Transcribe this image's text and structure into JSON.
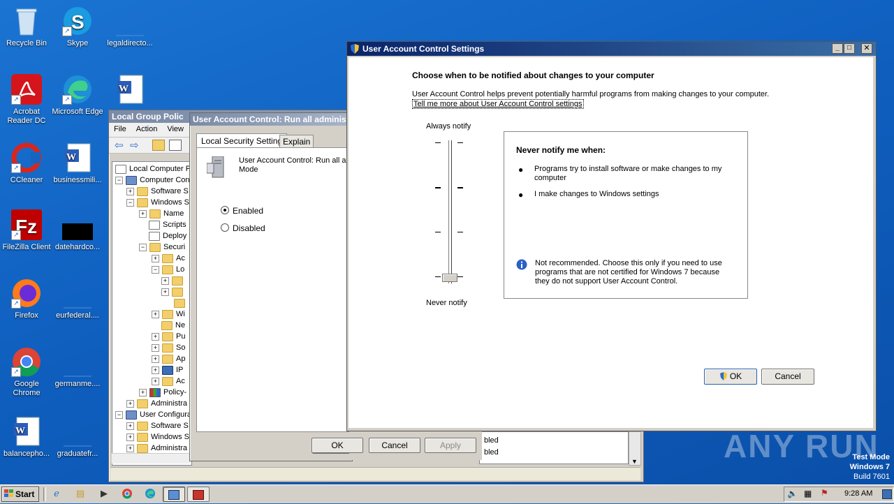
{
  "desktop": {
    "icons": [
      {
        "label": "Recycle Bin"
      },
      {
        "label": "Skype"
      },
      {
        "label": "legaldirecto..."
      },
      {
        "label": "Acrobat Reader DC"
      },
      {
        "label": "Microsoft Edge"
      },
      {
        "label": "CCleaner"
      },
      {
        "label": "businessmili..."
      },
      {
        "label": "FileZilla Client"
      },
      {
        "label": "datehardco..."
      },
      {
        "label": "Firefox"
      },
      {
        "label": "eurfederal...."
      },
      {
        "label": "Google Chrome"
      },
      {
        "label": "germanme...."
      },
      {
        "label": "balancepho..."
      },
      {
        "label": "graduatefr..."
      }
    ]
  },
  "gpo_window": {
    "title": "Local Group Polic",
    "menu": [
      "File",
      "Action",
      "View"
    ],
    "tree": [
      {
        "label": "Local Computer Po"
      },
      {
        "label": "Computer Con"
      },
      {
        "label": "Software S"
      },
      {
        "label": "Windows S"
      },
      {
        "label": "Name"
      },
      {
        "label": "Scripts"
      },
      {
        "label": "Deploy"
      },
      {
        "label": "Securi"
      },
      {
        "label": "Ac"
      },
      {
        "label": "Lo"
      },
      {
        "label": "Wi"
      },
      {
        "label": "Ne"
      },
      {
        "label": "Pu"
      },
      {
        "label": "So"
      },
      {
        "label": "Ap"
      },
      {
        "label": "IP"
      },
      {
        "label": "Ac"
      },
      {
        "label": "Policy-"
      },
      {
        "label": "Administra"
      },
      {
        "label": "User Configura"
      },
      {
        "label": "Software S"
      },
      {
        "label": "Windows S"
      },
      {
        "label": "Administra"
      }
    ],
    "list_values": [
      "bled",
      "bled"
    ]
  },
  "policy_dialog": {
    "title": "User Account Control: Run all administ",
    "tabs": [
      "Local Security Setting",
      "Explain"
    ],
    "policy_text_line1": "User Account Control: Run all ac",
    "policy_text_line2": "Mode",
    "option_enabled": "Enabled",
    "option_disabled": "Disabled",
    "selected": "Enabled",
    "ok": "OK",
    "cancel": "Cancel",
    "apply": "Apply"
  },
  "uac_dialog": {
    "title": "User Account Control Settings",
    "heading": "Choose when to be notified about changes to your computer",
    "description": "User Account Control helps prevent potentially harmful programs from making changes to your computer.",
    "link": "Tell me more about User Account Control settings",
    "slider_top_label": "Always notify",
    "slider_bottom_label": "Never notify",
    "slider_level": 0,
    "slider_levels_total": 4,
    "info_heading": "Never notify me when:",
    "bullets": [
      "Programs try to install software or make changes to my computer",
      "I make changes to Windows settings"
    ],
    "warning": "Not recommended. Choose this only if you need to use programs that are not certified for Windows 7 because they do not support User Account Control.",
    "ok": "OK",
    "cancel": "Cancel"
  },
  "taskbar": {
    "start": "Start",
    "clock": "9:28 AM"
  },
  "watermark": {
    "brand": "ANY RUN",
    "line1": "Test Mode",
    "line2": "Windows 7",
    "line3": "Build 7601"
  },
  "colors": {
    "desktop": "#0f5fbf",
    "active_title": "#0a246a",
    "info_icon": "#2b61c6"
  }
}
